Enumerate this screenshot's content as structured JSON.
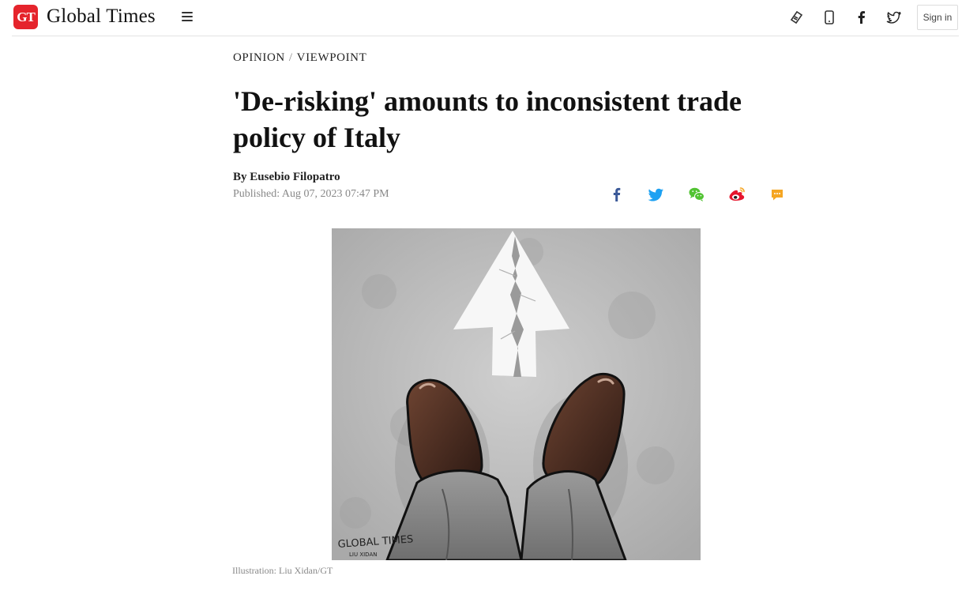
{
  "header": {
    "logo_badge": "GT",
    "logo_text": "Global Times",
    "menu_icon": "hamburger-menu-icon",
    "icons": [
      "epaper-icon",
      "mobile-icon",
      "facebook-icon",
      "twitter-icon"
    ],
    "signin_label": "Sign in"
  },
  "article": {
    "breadcrumb": [
      "OPINION",
      "VIEWPOINT"
    ],
    "breadcrumb_separator": "/",
    "title": "'De-risking' amounts to inconsistent trade policy of Italy",
    "byline": "By Eusebio Filopatro",
    "published": "Published: Aug 07, 2023 07:47 PM",
    "share_icons": [
      "facebook-share-icon",
      "twitter-share-icon",
      "wechat-share-icon",
      "weibo-share-icon",
      "comment-icon"
    ],
    "image_watermark": [
      "GLOBAL TIMES",
      "LIU XIDAN"
    ],
    "caption": "Illustration: Liu Xidan/GT"
  },
  "colors": {
    "brand_red": "#e5242c",
    "facebook_blue": "#3b5998",
    "twitter_blue": "#1da1f2",
    "wechat_green": "#51c332",
    "weibo_red": "#e6162d",
    "comment_orange": "#f5a623"
  }
}
